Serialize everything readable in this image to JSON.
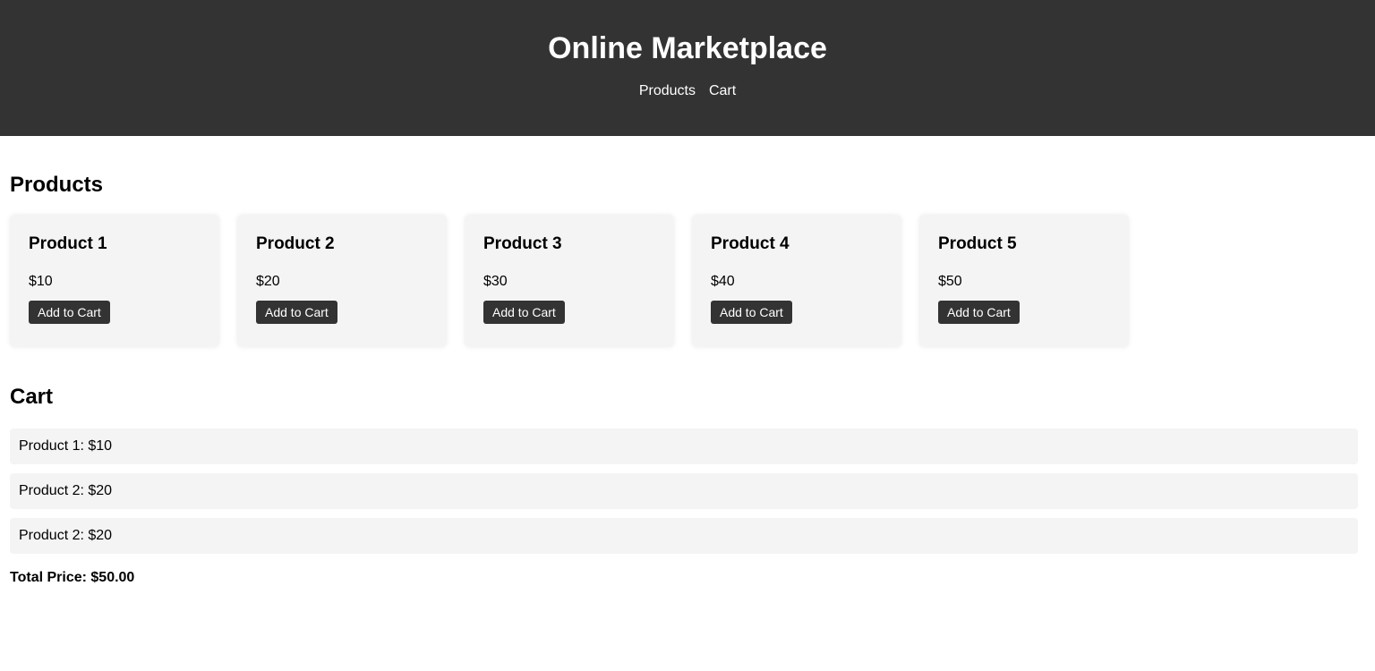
{
  "header": {
    "title": "Online Marketplace",
    "nav": [
      "Products",
      "Cart"
    ]
  },
  "products_section": {
    "title": "Products",
    "items": [
      {
        "name": "Product 1",
        "price": "$10",
        "button": "Add to Cart"
      },
      {
        "name": "Product 2",
        "price": "$20",
        "button": "Add to Cart"
      },
      {
        "name": "Product 3",
        "price": "$30",
        "button": "Add to Cart"
      },
      {
        "name": "Product 4",
        "price": "$40",
        "button": "Add to Cart"
      },
      {
        "name": "Product 5",
        "price": "$50",
        "button": "Add to Cart"
      }
    ]
  },
  "cart_section": {
    "title": "Cart",
    "items": [
      "Product 1: $10",
      "Product 2: $20",
      "Product 2: $20"
    ],
    "total": "Total Price: $50.00"
  },
  "colors": {
    "header_bg": "#333333",
    "card_bg": "#f4f4f4",
    "button_bg": "#333333"
  }
}
